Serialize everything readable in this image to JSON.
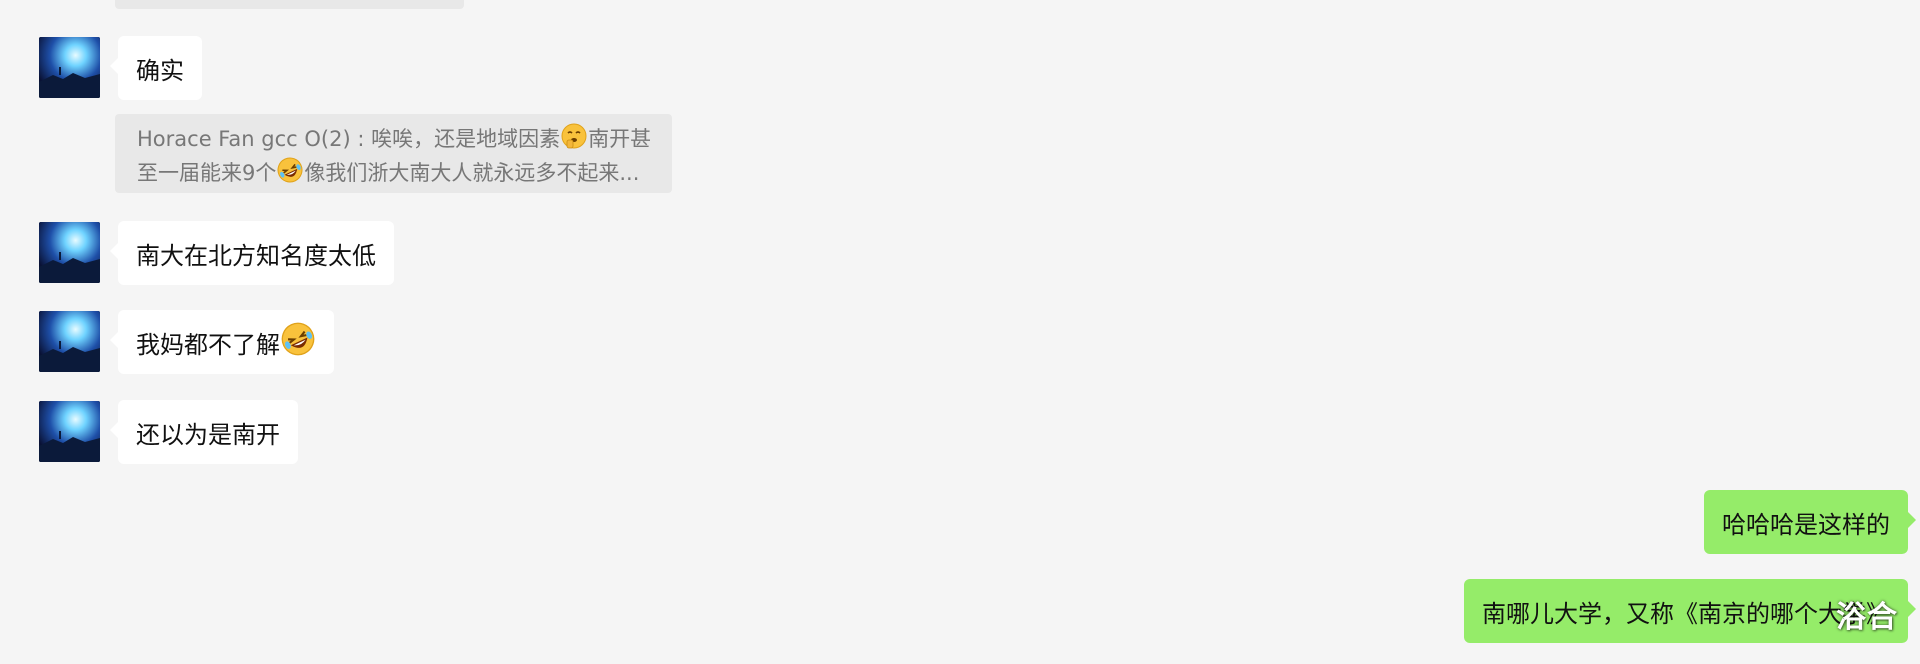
{
  "messages": [
    {
      "side": "left",
      "text": "确实"
    },
    {
      "side": "left",
      "text": "南大在北方知名度太低"
    },
    {
      "side": "left",
      "text": "我妈都不了解"
    },
    {
      "side": "left",
      "text": "还以为是南开"
    },
    {
      "side": "right",
      "text": "哈哈哈是这样的"
    },
    {
      "side": "right",
      "text": "南哪儿大学，又称《南京的哪个大学》"
    }
  ],
  "quote": {
    "sender": "Horace Fan gcc O(2)",
    "separator": " : ",
    "line1_a": "唉唉，还是地域因素",
    "line1_b": "南开甚",
    "line2_a": "至一届能来9个",
    "line2_b": "像我们浙大南大人就永远多不起来..."
  },
  "emojis": {
    "quote_emoji_1": "shushing-face",
    "quote_emoji_2": "rolling-on-floor-laughing",
    "message_emoji": "rolling-on-floor-laughing"
  },
  "watermark": "浴合",
  "colors": {
    "background": "#f5f5f5",
    "incoming_bubble": "#ffffff",
    "outgoing_bubble": "#95ec69",
    "quote_background": "#e8e8e8"
  }
}
